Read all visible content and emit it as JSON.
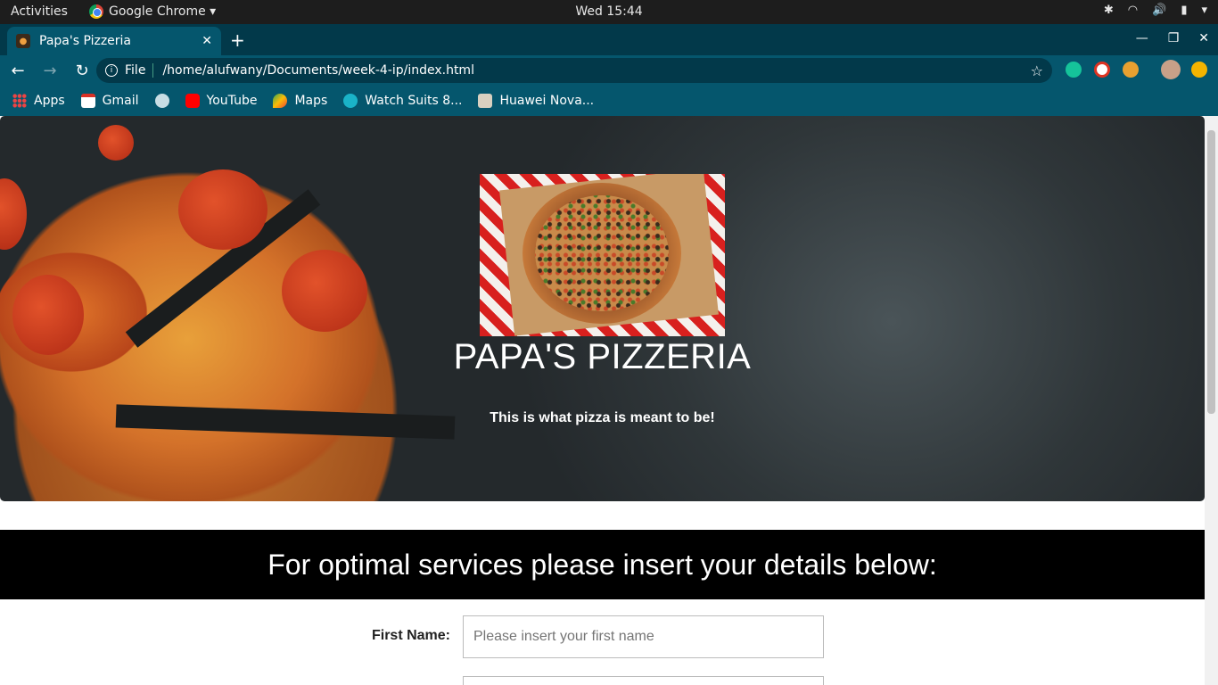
{
  "os": {
    "activities": "Activities",
    "app_menu": "Google Chrome ▾",
    "clock": "Wed 15:44"
  },
  "browser": {
    "tab_title": "Papa's Pizzeria",
    "url_scheme": "File",
    "url": "/home/alufwany/Documents/week-4-ip/index.html",
    "bookmarks": [
      "Apps",
      "Gmail",
      "",
      "YouTube",
      "Maps",
      "Watch Suits 8...",
      "Huawei Nova..."
    ]
  },
  "page": {
    "hero": {
      "title": "PAPA'S PIZZERIA",
      "tagline": "This is what pizza is meant to be!"
    },
    "banner": "For optimal services please insert your details below:",
    "form": {
      "first_name_label": "First Name:",
      "first_name_placeholder": "Please insert your first name",
      "first_name_value": ""
    }
  },
  "colors": {
    "chrome_frame": "#02394a",
    "chrome_toolbar": "#05566d",
    "banner_bg": "#000000"
  }
}
